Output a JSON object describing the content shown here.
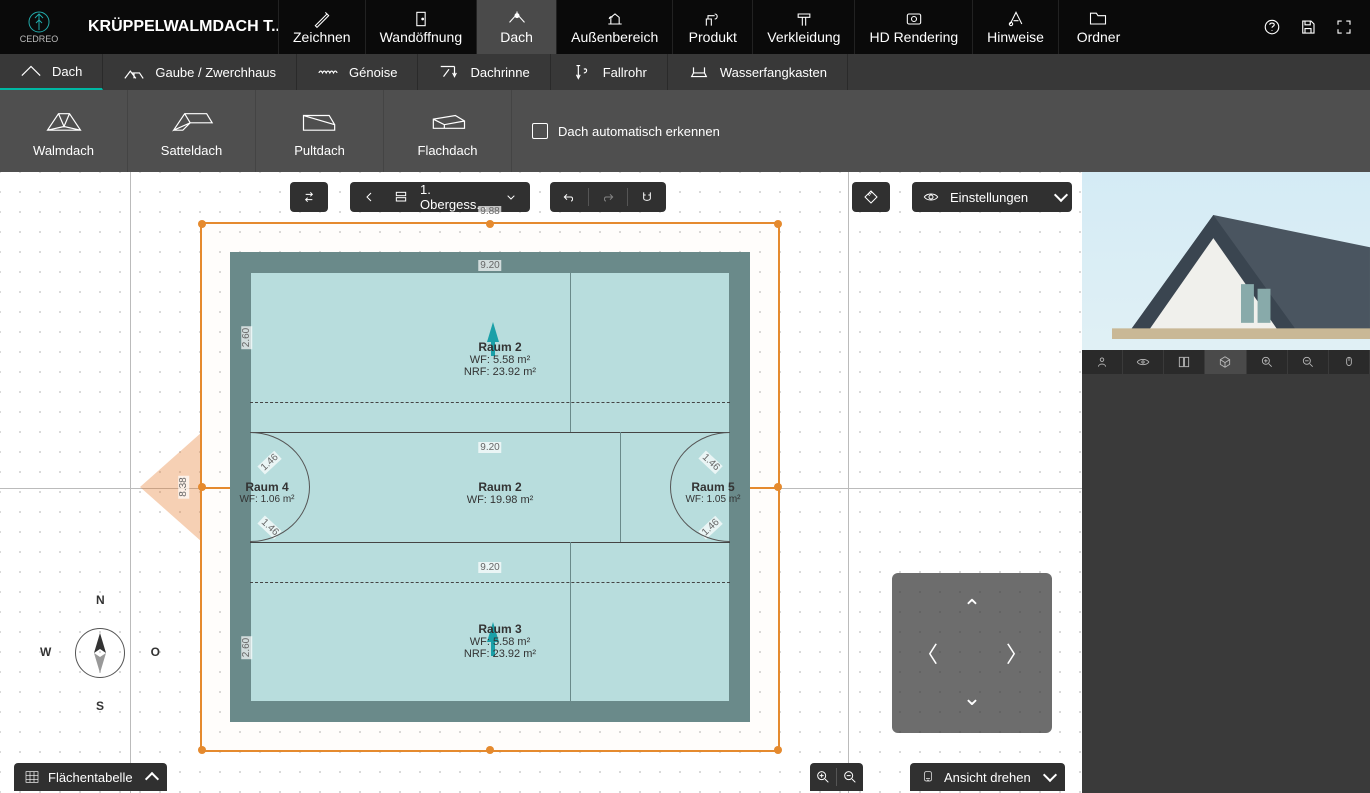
{
  "app": {
    "brand": "CEDREO",
    "project_title": "KRÜPPELWALMDACH T..."
  },
  "main_tabs": [
    {
      "label": "Zeichnen"
    },
    {
      "label": "Wandöffnung"
    },
    {
      "label": "Dach",
      "active": true
    },
    {
      "label": "Außenbereich"
    },
    {
      "label": "Produkt"
    },
    {
      "label": "Verkleidung"
    },
    {
      "label": "HD Rendering"
    },
    {
      "label": "Hinweise"
    },
    {
      "label": "Ordner"
    }
  ],
  "sub_tabs": [
    {
      "label": "Dach",
      "active": true
    },
    {
      "label": "Gaube / Zwerchhaus"
    },
    {
      "label": "Génoise"
    },
    {
      "label": "Dachrinne"
    },
    {
      "label": "Fallrohr"
    },
    {
      "label": "Wasserfangkasten"
    }
  ],
  "palette": [
    {
      "label": "Walmdach"
    },
    {
      "label": "Satteldach"
    },
    {
      "label": "Pultdach"
    },
    {
      "label": "Flachdach"
    }
  ],
  "palette_option": {
    "auto_detect_label": "Dach automatisch erkennen",
    "checked": false
  },
  "level_selector": {
    "label": "1. Obergeschoss",
    "short": "1. Obergess..."
  },
  "settings_label": "Einstellungen",
  "bottom": {
    "flaechen": "Flächentabelle",
    "ansicht": "Ansicht drehen"
  },
  "compass": {
    "n": "N",
    "s": "S",
    "w": "W",
    "o": "O"
  },
  "plan": {
    "outer_width": "9.88",
    "inner_width": "9.20",
    "height": "8.38",
    "room2_top": {
      "name": "Raum 2",
      "wf": "WF: 5.58 m²",
      "nrf": "NRF: 23.92 m²"
    },
    "room2_mid": {
      "name": "Raum 2",
      "wf": "WF: 19.98 m²"
    },
    "room3": {
      "name": "Raum 3",
      "wf": "WF: 5.58 m²",
      "nrf": "NRF: 23.92 m²"
    },
    "room4": {
      "name": "Raum 4",
      "wf": "WF: 1.06 m²"
    },
    "room5": {
      "name": "Raum 5",
      "wf": "WF: 1.05 m²"
    },
    "side_h": "2.60",
    "diag": "1.46"
  }
}
